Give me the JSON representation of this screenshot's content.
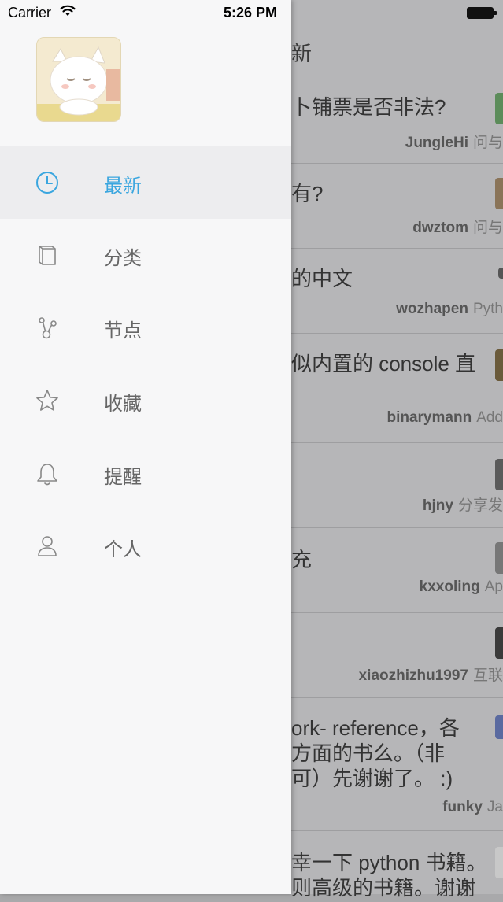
{
  "status_bar": {
    "carrier": "Carrier",
    "time": "5:26 PM"
  },
  "menu": [
    {
      "label": "最新",
      "icon": "clock-icon",
      "active": true
    },
    {
      "label": "分类",
      "icon": "book-icon",
      "active": false
    },
    {
      "label": "节点",
      "icon": "node-icon",
      "active": false
    },
    {
      "label": "收藏",
      "icon": "star-icon",
      "active": false
    },
    {
      "label": "提醒",
      "icon": "bell-icon",
      "active": false
    },
    {
      "label": "个人",
      "icon": "person-icon",
      "active": false
    }
  ],
  "colors": {
    "accent": "#3aa6df",
    "menu_text": "#666666"
  },
  "main": {
    "title": "新",
    "rows": [
      {
        "title": "卜铺票是否非法?",
        "user": "JungleHi",
        "node": "问与"
      },
      {
        "title": "有?",
        "user": "dwztom",
        "node": "问与"
      },
      {
        "title": "的中文",
        "user": "wozhapen",
        "node": "Pyth"
      },
      {
        "title": "似内置的 console 直",
        "user": "binarymann",
        "node": "Add"
      },
      {
        "title": "",
        "user": "hjny",
        "node": "分享发"
      },
      {
        "title": "充",
        "user": "kxxoling",
        "node": "Ap"
      },
      {
        "title": "",
        "user": "xiaozhizhu1997",
        "node": "互联"
      },
      {
        "title": "ork- reference，各",
        "title2": "方面的书么。（非",
        "title3": "可）先谢谢了。 :)",
        "user": "funky",
        "node": "Ja"
      },
      {
        "title": "幸一下 python 书籍。",
        "title2": "则高级的书籍。谢谢"
      }
    ]
  }
}
